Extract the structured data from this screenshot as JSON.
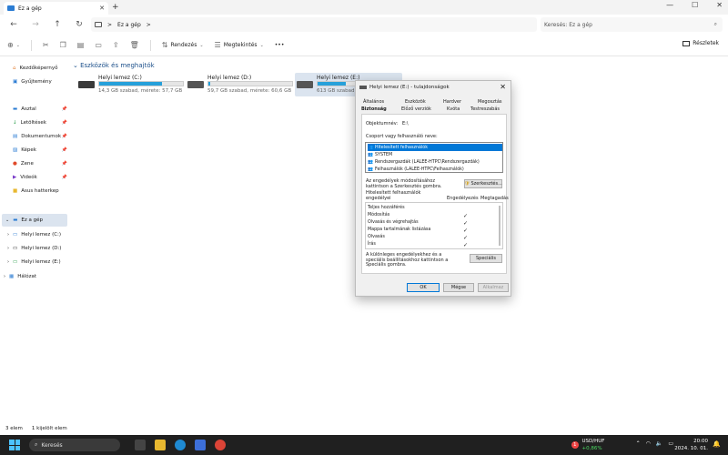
{
  "window": {
    "tab_title": "Ez a gép",
    "win_min": "—",
    "win_max": "☐",
    "win_close": "✕"
  },
  "address": {
    "crumb": "Ez a gép",
    "sep1": ">",
    "sep2": ">",
    "search_placeholder": "Keresés: Ez a gép"
  },
  "toolbar": {
    "new_label": "⊕",
    "sort_label": "Rendezés",
    "view_label": "Megtekintés",
    "more_label": "•••",
    "details_label": "Részletek"
  },
  "sidebar": {
    "quick": [
      {
        "label": "Kezdőképernyő"
      },
      {
        "label": "Gyűjtemény"
      }
    ],
    "pinned": [
      {
        "label": "Asztal"
      },
      {
        "label": "Letöltések"
      },
      {
        "label": "Dokumentumok"
      },
      {
        "label": "Képek"
      },
      {
        "label": "Zene"
      },
      {
        "label": "Videók"
      },
      {
        "label": "Asus hatterkep"
      }
    ],
    "tree": [
      {
        "label": "Ez a gép"
      },
      {
        "label": "Helyi lemez (C:)"
      },
      {
        "label": "Helyi lemez (D:)"
      },
      {
        "label": "Helyi lemez (E:)"
      },
      {
        "label": "Hálózat"
      }
    ]
  },
  "main": {
    "section_title": "Eszközök és meghajtók",
    "drives": [
      {
        "name": "Helyi lemez (C:)",
        "info": "14,3 GB szabad, mérete: 57,7 GB",
        "used": 0.75
      },
      {
        "name": "Helyi lemez (D:)",
        "info": "59,7 GB szabad, mérete: 60,6 GB",
        "used": 0.02
      },
      {
        "name": "Helyi lemez (E:)",
        "info": "613 GB szabad,",
        "used": 0.34
      }
    ]
  },
  "status": {
    "count": "3 elem",
    "selected": "1 kijelölt elem"
  },
  "dialog": {
    "title": "Helyi lemez (E:) - tulajdonságok",
    "tabs": [
      "Általános",
      "Eszközök",
      "Hardver",
      "Megosztás",
      "Biztonság",
      "Előző verziók",
      "Kvóta",
      "Testreszabás"
    ],
    "object_label": "Objektumnév:",
    "object_value": "E:\\",
    "group_label": "Csoport vagy felhasználó neve:",
    "groups": [
      "Hitelesített felhasználók",
      "SYSTEM",
      "Rendszergazdák (LALEE-HTPC\\Rendszergazdák)",
      "Felhasználók (LALEE-HTPC\\Felhasználók)"
    ],
    "edit_hint": "Az engedélyek módosításához kattintson a Szerkesztés gombra.",
    "edit_button": "Szerkesztés...",
    "perm_for": "Hitelesített felhasználók engedélyei",
    "col_allow": "Engedélyezés",
    "col_deny": "Megtagadás",
    "permissions": [
      {
        "name": "Teljes hozzáférés",
        "allow": ""
      },
      {
        "name": "Módosítás",
        "allow": "✓"
      },
      {
        "name": "Olvasás és végrehajtás",
        "allow": "✓"
      },
      {
        "name": "Mappa tartalmának listázása",
        "allow": "✓"
      },
      {
        "name": "Olvasás",
        "allow": "✓"
      },
      {
        "name": "Írás",
        "allow": "✓"
      }
    ],
    "special_hint": "A különleges engedélyekhez és a speciális beállításokhoz kattintson a Speciális gombra.",
    "special_button": "Speciális",
    "ok": "OK",
    "cancel": "Mégse",
    "apply": "Alkalmaz"
  },
  "taskbar": {
    "search_label": "Keresés",
    "stock_name": "USD/HUF",
    "stock_change": "+0,86%",
    "stock_badge": "1",
    "time": "20:00",
    "date": "2024. 10. 01."
  }
}
